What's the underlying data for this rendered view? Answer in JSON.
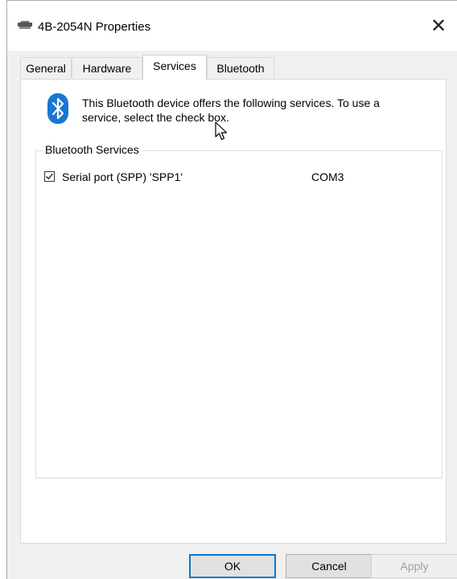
{
  "window": {
    "title": "4B-2054N Properties",
    "close_glyph": "✕"
  },
  "tabs": [
    {
      "label": "General",
      "active": false
    },
    {
      "label": "Hardware",
      "active": false
    },
    {
      "label": "Services",
      "active": true
    },
    {
      "label": "Bluetooth",
      "active": false
    }
  ],
  "services_page": {
    "icon": "bluetooth-icon",
    "intro_text": "This Bluetooth device offers the following services. To use a service, select the check box.",
    "group_label": "Bluetooth Services",
    "services": [
      {
        "name": "Serial port (SPP) 'SPP1'",
        "port": "COM3",
        "checked": true
      }
    ]
  },
  "buttons": {
    "ok_label": "OK",
    "cancel_label": "Cancel",
    "apply_label": "Apply"
  },
  "colors": {
    "accent": "#0078d7",
    "bluetooth": "#1976d2"
  }
}
